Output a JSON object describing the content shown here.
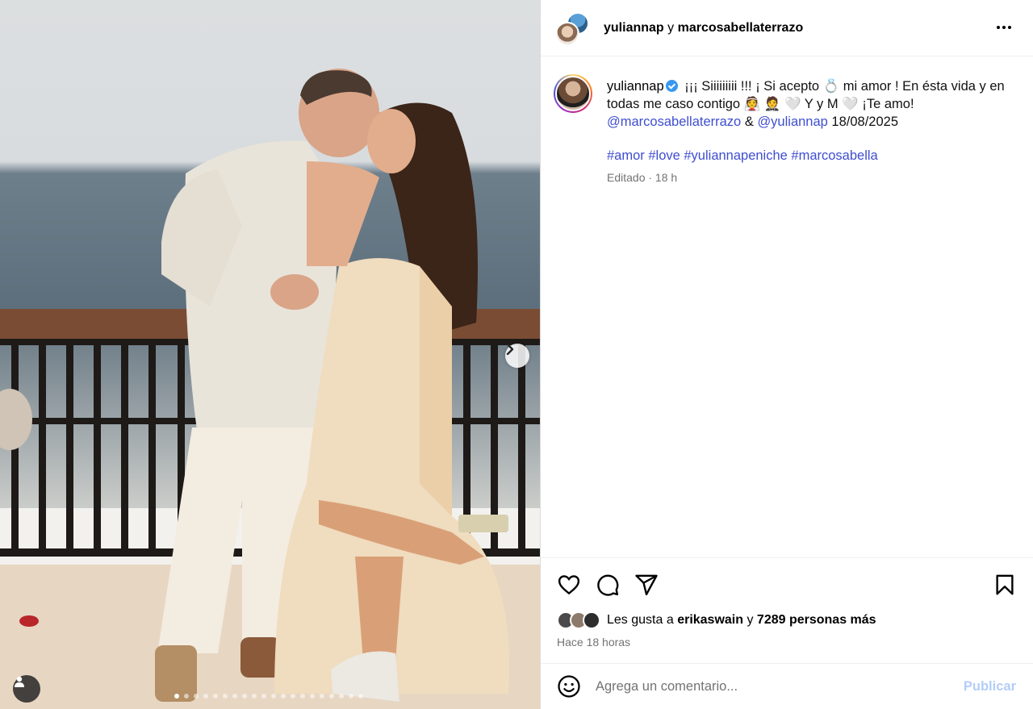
{
  "header": {
    "user1": "yuliannap",
    "joiner": "y",
    "user2": "marcosabellaterrazo",
    "more_icon": "more-horizontal-icon"
  },
  "caption": {
    "username": "yuliannap",
    "verified_icon": "verified-badge-icon",
    "text_part1": "¡¡¡ Siiiiiiiii !!! ¡ Si acepto 💍 mi amor ! En ésta vida y en todas me caso contigo 👰 🤵 🤍 Y y M 🤍 ¡Te amo!",
    "mention1": "@marcosabellaterrazo",
    "amp": "&",
    "mention2": "@yuliannap",
    "date": "18/08/2025",
    "hashtags": "#amor #love #yuliannapeniche #marcosabella",
    "edited": "Editado · 18 h"
  },
  "actions": {
    "like_icon": "heart-icon",
    "comment_icon": "comment-icon",
    "share_icon": "share-icon",
    "save_icon": "bookmark-icon"
  },
  "likes": {
    "prefix": "Les gusta a",
    "user": "erikaswain",
    "joiner": "y",
    "others": "7289 personas más",
    "liker_colors": [
      "#4a4a4a",
      "#8c7a6b",
      "#2d2d2d"
    ]
  },
  "posted_ago": "Hace 18 horas",
  "comment": {
    "placeholder": "Agrega un comentario...",
    "publish_label": "Publicar",
    "emoji_icon": "emoji-icon"
  },
  "media": {
    "tag_icon": "user-tag-icon",
    "next_icon": "chevron-right-icon",
    "carousel_total": 20,
    "carousel_active": 1
  },
  "colors": {
    "link": "#3f4ed0",
    "publish_disabled": "#b3cdf8",
    "muted": "#737373"
  }
}
